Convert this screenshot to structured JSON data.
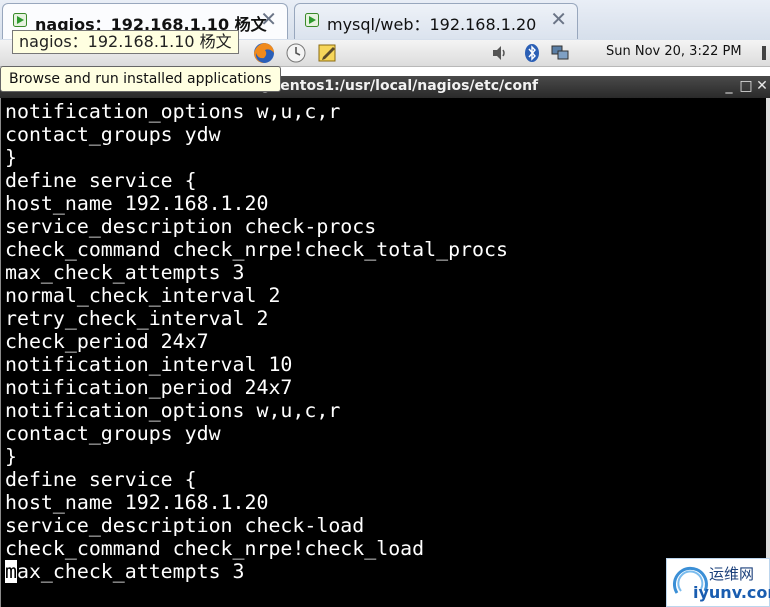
{
  "tabs": [
    {
      "title": "nagios：192.168.1.10 杨文",
      "close": "✕"
    },
    {
      "title": "mysql/web：192.168.1.20",
      "close": "✕"
    }
  ],
  "tooltip": {
    "text": "nagios：192.168.1.10 杨文"
  },
  "panel": {
    "clock": "Sun Nov 20,  3:22 PM",
    "launcher_tooltip": "Browse and run installed applications"
  },
  "terminal": {
    "title": "@centos1:/usr/local/nagios/etc/conf",
    "buttons": {
      "minimize": "_",
      "maximize": "□",
      "close": "✕"
    },
    "lines": [
      "notification_options w,u,c,r",
      "contact_groups ydw",
      "}",
      "define service {",
      "host_name 192.168.1.20",
      "service_description check-procs",
      "check_command check_nrpe!check_total_procs",
      "max_check_attempts 3",
      "normal_check_interval 2",
      "retry_check_interval 2",
      "check_period 24x7",
      "notification_interval 10",
      "notification_period 24x7",
      "notification_options w,u,c,r",
      "contact_groups ydw",
      "}",
      "define service {",
      "host_name 192.168.1.20",
      "service_description check-load",
      "check_command check_nrpe!check_load",
      "max_check_attempts 3"
    ],
    "cursor_line_index": 20
  },
  "watermark": {
    "cn": "运维网",
    "en": "iyunv.com"
  },
  "colors": {
    "terminal_bg": "#000000",
    "terminal_fg": "#ffffff",
    "tooltip_bg": "#ffffe1"
  }
}
